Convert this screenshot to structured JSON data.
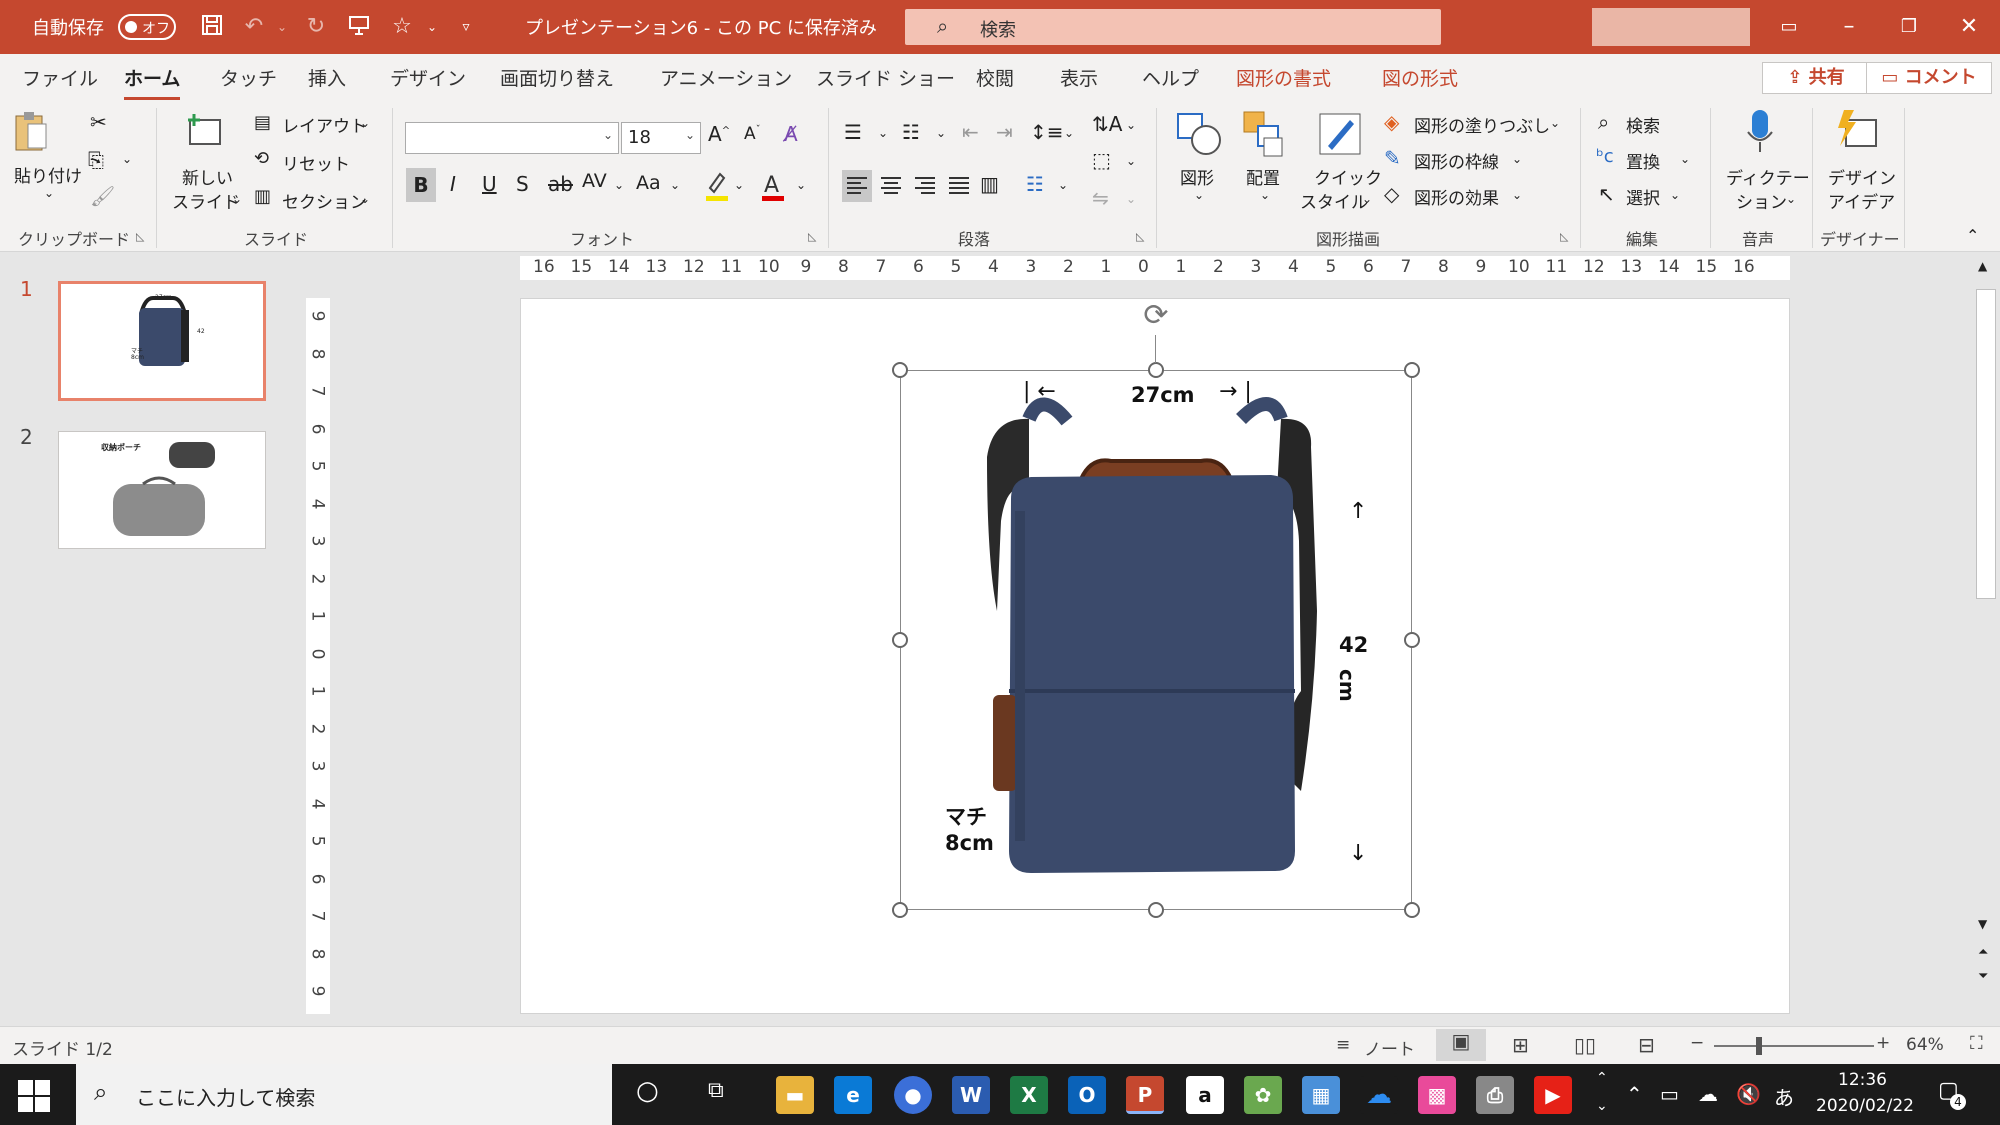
{
  "titlebar": {
    "autosave_label": "自動保存",
    "autosave_state": "オフ",
    "title": "プレゼンテーション6 - この PC に保存済み",
    "search_placeholder": "検索"
  },
  "tabs": [
    {
      "label": "ファイル"
    },
    {
      "label": "ホーム"
    },
    {
      "label": "タッチ"
    },
    {
      "label": "挿入"
    },
    {
      "label": "デザイン"
    },
    {
      "label": "画面切り替え"
    },
    {
      "label": "アニメーション"
    },
    {
      "label": "スライド ショー"
    },
    {
      "label": "校閲"
    },
    {
      "label": "表示"
    },
    {
      "label": "ヘルプ"
    },
    {
      "label": "図形の書式"
    },
    {
      "label": "図の形式"
    }
  ],
  "share_label": "共有",
  "comment_label": "コメント",
  "ribbon": {
    "clipboard": {
      "paste": "貼り付け",
      "group": "クリップボード"
    },
    "slides": {
      "new_slide_1": "新しい",
      "new_slide_2": "スライド",
      "layout": "レイアウト",
      "reset": "リセット",
      "section": "セクション",
      "group": "スライド"
    },
    "font": {
      "name": "",
      "size": "18",
      "group": "フォント"
    },
    "paragraph": {
      "group": "段落"
    },
    "drawing": {
      "shapes": "図形",
      "arrange": "配置",
      "quick_1": "クイック",
      "quick_2": "スタイル",
      "fill": "図形の塗りつぶし",
      "outline": "図形の枠線",
      "effects": "図形の効果",
      "group": "図形描画"
    },
    "editing": {
      "find": "検索",
      "replace": "置換",
      "select": "選択",
      "group": "編集"
    },
    "voice": {
      "dictate_1": "ディクテー",
      "dictate_2": "ション",
      "group": "音声"
    },
    "designer": {
      "idea_1": "デザイン",
      "idea_2": "アイデア",
      "group": "デザイナー"
    }
  },
  "thumbnails": [
    {
      "num": "1",
      "dims": {
        "w": "27cm",
        "h": "42",
        "d1": "マチ",
        "d2": "8cm"
      }
    },
    {
      "num": "2",
      "title": "収納ポーチ"
    }
  ],
  "ruler": {
    "h_ticks": [
      "16",
      "15",
      "14",
      "13",
      "12",
      "11",
      "10",
      "9",
      "8",
      "7",
      "6",
      "5",
      "4",
      "3",
      "2",
      "1",
      "0",
      "1",
      "2",
      "3",
      "4",
      "5",
      "6",
      "7",
      "8",
      "9",
      "10",
      "11",
      "12",
      "13",
      "14",
      "15",
      "16"
    ],
    "v_ticks": [
      "9",
      "8",
      "7",
      "6",
      "5",
      "4",
      "3",
      "2",
      "1",
      "0",
      "1",
      "2",
      "3",
      "4",
      "5",
      "6",
      "7",
      "8",
      "9"
    ]
  },
  "slide": {
    "width_label": "27cm",
    "height_num": "42",
    "height_unit": "cm",
    "depth_1": "マチ",
    "depth_2": "8cm"
  },
  "status": {
    "slide_info": "スライド 1/2",
    "notes": "ノート",
    "zoom": "64%"
  },
  "taskbar": {
    "search_placeholder": "ここに入力して検索",
    "time": "12:36",
    "date": "2020/02/22",
    "ime": "あ",
    "notifications": "4"
  }
}
